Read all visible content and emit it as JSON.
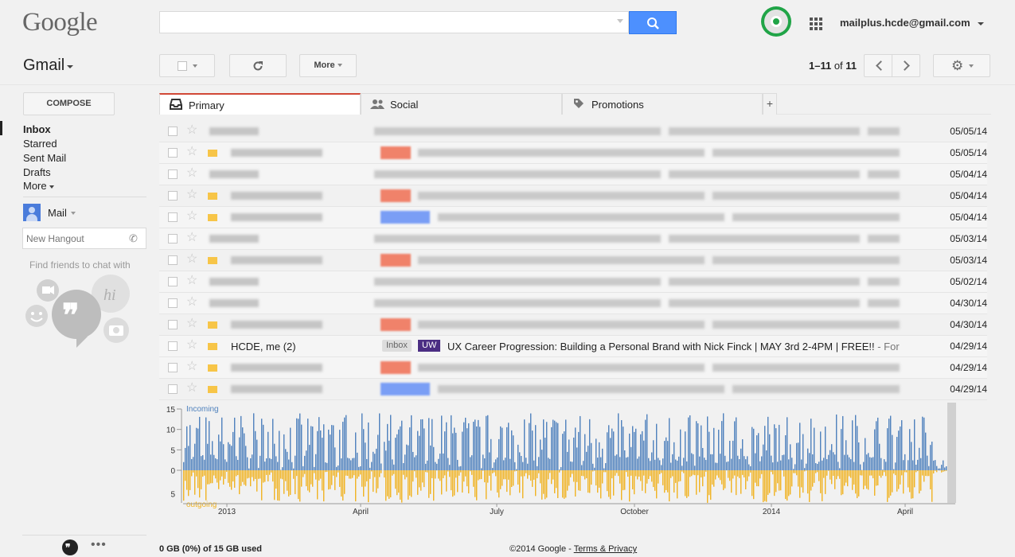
{
  "header": {
    "logo": "Google",
    "account_email": "mailplus.hcde@gmail.com",
    "search_value": "",
    "search_icon": "search-icon",
    "apps_icon": "apps-grid-icon",
    "profile_color": "#20a447"
  },
  "toolbar": {
    "app_label": "Gmail",
    "more_label": "More",
    "pager_range": "1–11",
    "pager_of": "of",
    "pager_total": "11"
  },
  "sidebar": {
    "compose_label": "COMPOSE",
    "items": [
      {
        "label": "Inbox",
        "active": true
      },
      {
        "label": "Starred"
      },
      {
        "label": "Sent Mail"
      },
      {
        "label": "Drafts"
      },
      {
        "label": "More"
      }
    ],
    "mail_label": "Mail",
    "hangout_placeholder": "New Hangout",
    "find_friends": "Find friends to chat with"
  },
  "tabs": [
    {
      "label": "Primary",
      "icon": "inbox-tray-icon",
      "active": true
    },
    {
      "label": "Social",
      "icon": "people-icon"
    },
    {
      "label": "Promotions",
      "icon": "tag-icon"
    },
    {
      "label": "+"
    }
  ],
  "messages": [
    {
      "date": "05/05/14",
      "label_color": null,
      "tag_color": null
    },
    {
      "date": "05/05/14",
      "label_color": "#f7c548",
      "tag_color": "#f0826a"
    },
    {
      "date": "05/04/14",
      "label_color": null,
      "tag_color": null
    },
    {
      "date": "05/04/14",
      "label_color": "#f7c548",
      "tag_color": "#f0826a"
    },
    {
      "date": "05/04/14",
      "label_color": "#f7c548",
      "tag_color": "#7a9ef5"
    },
    {
      "date": "05/03/14",
      "label_color": null,
      "tag_color": null
    },
    {
      "date": "05/03/14",
      "label_color": "#f7c548",
      "tag_color": "#f0826a"
    },
    {
      "date": "05/02/14",
      "label_color": null,
      "tag_color": null
    },
    {
      "date": "04/30/14",
      "label_color": null,
      "tag_color": null
    },
    {
      "date": "04/30/14",
      "label_color": "#f7c548",
      "tag_color": "#f0826a"
    },
    {
      "date": "04/29/14",
      "label_color": "#f7c548",
      "tag_color": null,
      "sender": "HCDE, me (2)",
      "inbox_chip": "Inbox",
      "uw_chip": "UW",
      "subject": "UX Career Progression: Building a Personal Brand with Nick Finck | MAY 3rd 2-4PM | FREE!!",
      "snippet": " - For"
    },
    {
      "date": "04/29/14",
      "label_color": "#f7c548",
      "tag_color": "#f0826a"
    },
    {
      "date": "04/29/14",
      "label_color": "#f7c548",
      "tag_color": "#7a9ef5"
    }
  ],
  "chart_data": {
    "type": "bar",
    "series": [
      {
        "name": "incoming",
        "color": "#4f81bd"
      },
      {
        "name": "outgoing",
        "color": "#f0b323"
      }
    ],
    "series_labels": {
      "incoming": "Incoming",
      "outgoing": "outgoing"
    },
    "y_ticks_top": [
      "15",
      "10",
      "5",
      "0"
    ],
    "y_ticks_bottom": [
      "5"
    ],
    "x_ticks": [
      "2013",
      "April",
      "July",
      "October",
      "2014",
      "April"
    ],
    "ylim_incoming": [
      0,
      15
    ],
    "ylim_outgoing": [
      0,
      7
    ]
  },
  "footer": {
    "storage": "0 GB (0%) of 15 GB used",
    "copyright": "©2014 Google - ",
    "terms": "Terms & Privacy"
  }
}
